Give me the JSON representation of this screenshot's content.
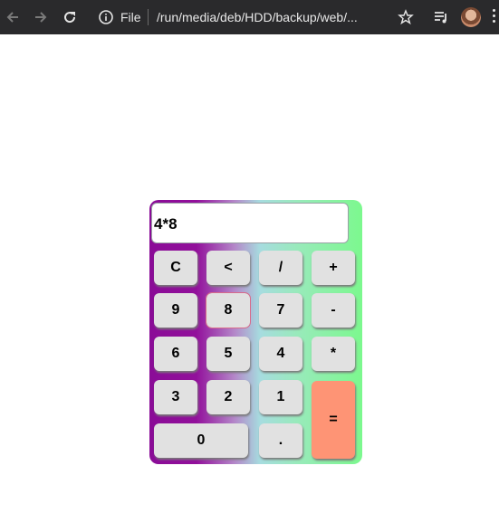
{
  "browser": {
    "file_label": "File",
    "url": "/run/media/deb/HDD/backup/web/..."
  },
  "calculator": {
    "display": "4*8",
    "keys": {
      "clear": "C",
      "back": "<",
      "divide": "/",
      "plus": "+",
      "nine": "9",
      "eight": "8",
      "seven": "7",
      "minus": "-",
      "six": "6",
      "five": "5",
      "four": "4",
      "multiply": "*",
      "three": "3",
      "two": "2",
      "one": "1",
      "equals": "=",
      "zero": "0",
      "dot": "."
    },
    "colors": {
      "gradient": [
        "#8a0c97",
        "#a6dcdf",
        "#7cf88e"
      ],
      "key": "#e1e1e1",
      "equals": "#fe9475"
    }
  },
  "icons": [
    "back-arrow-icon",
    "forward-arrow-icon",
    "reload-icon",
    "info-icon",
    "star-icon",
    "media-playlist-icon",
    "avatar",
    "menu-dots-icon"
  ]
}
